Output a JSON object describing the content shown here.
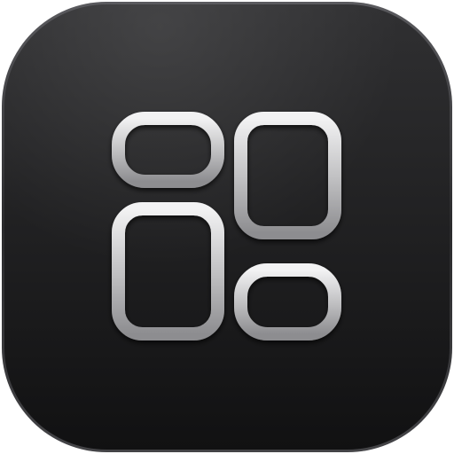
{
  "icon": {
    "name": "widget-grid-icon",
    "tile_color_top": "#303032",
    "tile_color_bottom": "#111112",
    "glyph_color_light": "#f2f2f3",
    "glyph_color_mid": "#bdbdbf",
    "glyph_color_dark": "#8d8d90"
  }
}
